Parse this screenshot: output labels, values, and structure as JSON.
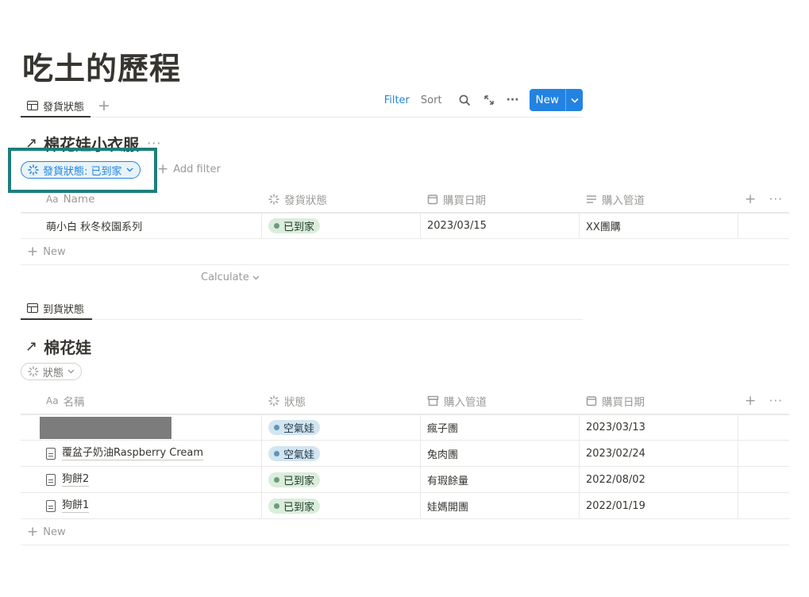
{
  "page": {
    "title": "吃土的歷程"
  },
  "view1": {
    "tab_label": "發貨狀態",
    "add_view": "+",
    "toolbar": {
      "filter": "Filter",
      "sort": "Sort",
      "more": "···",
      "new": "New"
    },
    "db_title": "棉花娃小衣服",
    "db_more": "···",
    "filter_pill": "發貨狀態: 已到家",
    "add_filter": "Add filter",
    "columns": [
      "Name",
      "發貨狀態",
      "購買日期",
      "購入管道"
    ],
    "rows": [
      {
        "name": "萌小白 秋冬校園系列",
        "status": "已到家",
        "status_color": "#dbeddb",
        "date": "2023/03/15",
        "channel": "XX團購"
      }
    ],
    "new_row": "New",
    "calculate": "Calculate"
  },
  "view2": {
    "tab_label": "到貨狀態",
    "db_title": "棉花娃",
    "filter_pill": "狀態",
    "columns": [
      "名稱",
      "狀態",
      "購入管道",
      "購買日期"
    ],
    "rows": [
      {
        "name": "",
        "redacted": true,
        "status": "空氣娃",
        "status_color": "#d3e5ef",
        "channel": "瘋子團",
        "date": "2023/03/13"
      },
      {
        "name": "覆盆子奶油Raspberry Cream",
        "status": "空氣娃",
        "status_color": "#d3e5ef",
        "channel": "兔肉團",
        "date": "2023/02/24"
      },
      {
        "name": "狗餅2",
        "status": "已到家",
        "status_color": "#dbeddb",
        "channel": "有瑕餘量",
        "date": "2022/08/02"
      },
      {
        "name": "狗餅1",
        "status": "已到家",
        "status_color": "#dbeddb",
        "channel": "娃媽開團",
        "date": "2022/01/19"
      }
    ],
    "new_row": "New"
  },
  "colors": {
    "accent": "#2383e2",
    "highlight_box": "#1c7f7b"
  },
  "icons": [
    "table-icon",
    "plus-icon",
    "search-icon",
    "expand-icon",
    "more-icon",
    "chevron-down-icon",
    "status-icon",
    "calendar-icon",
    "text-lines-icon",
    "store-icon",
    "document-icon",
    "arrow-link-icon"
  ]
}
